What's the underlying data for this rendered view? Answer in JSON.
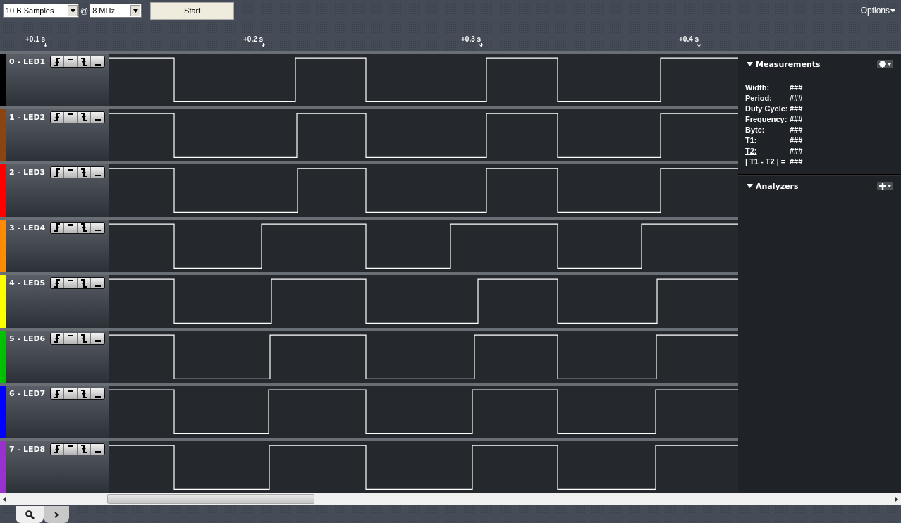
{
  "toolbar": {
    "samples": "10 B Samples",
    "separator": "@",
    "rate": "8 MHz",
    "start_button": "Start",
    "options": "Options"
  },
  "ruler": {
    "ticks": [
      "+0.1 s",
      "+0.2 s",
      "+0.3 s",
      "+0.4 s"
    ]
  },
  "channels": [
    {
      "name": "0 - LED1",
      "color": "#000000"
    },
    {
      "name": "1 - LED2",
      "color": "#8b4513"
    },
    {
      "name": "2 - LED3",
      "color": "#ff0000"
    },
    {
      "name": "3 - LED4",
      "color": "#ff8c00"
    },
    {
      "name": "4 - LED5",
      "color": "#ffff00"
    },
    {
      "name": "5 - LED6",
      "color": "#00c000"
    },
    {
      "name": "6 - LED7",
      "color": "#0000ff"
    },
    {
      "name": "7 - LED8",
      "color": "#9932cc"
    }
  ],
  "measurements": {
    "title": "Measurements",
    "rows": [
      {
        "label": "Width:",
        "value": "###",
        "underlined": false
      },
      {
        "label": "Period:",
        "value": "###",
        "underlined": false
      },
      {
        "label": "Duty Cycle:",
        "value": "###",
        "underlined": false
      },
      {
        "label": "Frequency:",
        "value": "###",
        "underlined": false
      },
      {
        "label": "Byte:",
        "value": "###",
        "underlined": false
      },
      {
        "label": "T1:",
        "value": "###",
        "underlined": true
      },
      {
        "label": "T2:",
        "value": "###",
        "underlined": true
      },
      {
        "label": "| T1 - T2 | =",
        "value": "###",
        "underlined": false
      }
    ]
  },
  "analyzers": {
    "title": "Analyzers"
  },
  "bottom_tabs": [
    {
      "kind": "search",
      "selected": true
    },
    {
      "kind": "next",
      "selected": false
    }
  ]
}
